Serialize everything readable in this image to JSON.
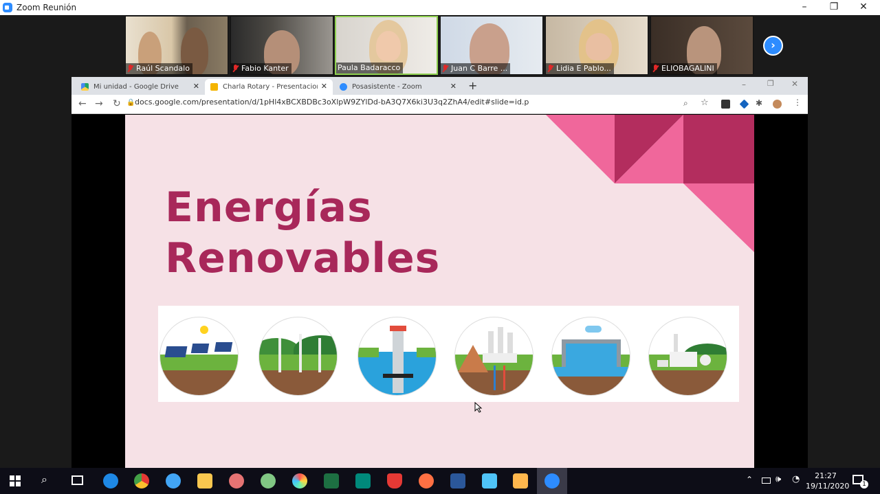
{
  "zoom": {
    "window_title": "Zoom Reunión",
    "participants": [
      {
        "name": "Raúl Scandalo",
        "muted": true
      },
      {
        "name": "Fabio Kanter",
        "muted": true
      },
      {
        "name": "Paula Badaracco",
        "muted": false,
        "active_speaker": true
      },
      {
        "name": "Juan C Barre ...",
        "muted": true
      },
      {
        "name": "Lidia E Pablo...",
        "muted": true
      },
      {
        "name": "ELIOBAGALINI",
        "muted": true
      }
    ],
    "next_icon": "chevron-right-icon",
    "window_controls": [
      "minimize",
      "restore",
      "close"
    ]
  },
  "browser": {
    "tabs": [
      {
        "label": "Mi unidad - Google Drive",
        "icon": "google-drive-icon",
        "selected": false
      },
      {
        "label": "Charla Rotary - Presentaciones d",
        "icon": "google-slides-icon",
        "selected": true
      },
      {
        "label": "Posasistente - Zoom",
        "icon": "zoom-icon",
        "selected": false
      }
    ],
    "new_tab": "+",
    "url": "docs.google.com/presentation/d/1pHl4xBCXBDBc3oXlpW9ZYlDd-bA3Q7X6ki3U3q2ZhA4/edit#slide=id.p"
  },
  "slide": {
    "title_line1": "Energías",
    "title_line2": "Renovables",
    "colors": {
      "background": "#f6e1e6",
      "title": "#a8285a",
      "accent_pink": "#f0679b",
      "accent_dark": "#b32d5e"
    },
    "icons": [
      "solar-energy-icon",
      "wind-energy-icon",
      "tidal-energy-icon",
      "geothermal-energy-icon",
      "hydroelectric-energy-icon",
      "biomass-energy-icon"
    ]
  },
  "taskbar": {
    "time": "21:27",
    "date": "19/11/2020",
    "notification_count": "1"
  }
}
